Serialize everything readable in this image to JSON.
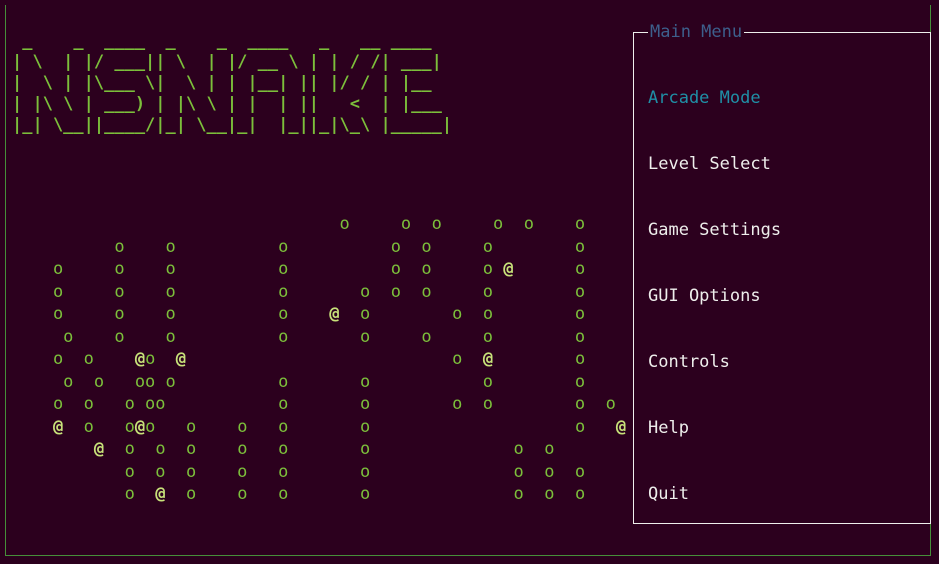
{
  "menu": {
    "title": "Main Menu",
    "selected_index": 0,
    "items": [
      "Arcade Mode",
      "Level Select",
      "Game Settings",
      "GUI Options",
      "Controls",
      "Help",
      "Quit"
    ]
  },
  "title_ascii": " _  __ ____  _  __ ____   _   __ ____ \n| |/ // ___|| |/ // __ \\ | | / // ___|\n|   | \\___ \\|   || |__| || |/ / | |__ \n| |\\ \\ ___) | |\\ || |  | ||   \\ | |___\n|_| \\_|____/|_| \\_|_|  |_||_|\\_\\|_____|",
  "title_ascii_rows": [
    " _    _  ____  _    _  ____   _   __ ____",
    "| \\  | |/ ___|| \\  | |/ __ \\ | | / /| ___|",
    "|  \\ | |\\___ \\|  \\ | | |__| || |/ / | |__",
    "| |\\ \\ | ___) | |\\ \\ | |  | ||   <  | |___",
    "|_| \\__||____/|_| \\__|_|  |_||_|\\_\\ |_____|"
  ],
  "playfield_rows": [
    "                                o     o  o     o  o    o",
    "          o    o          o          o  o     o        o",
    "    o     o    o          o          o  o     o @      o",
    "    o     o    o          o       o  o  o     o        o",
    "    o     o    o          o    @  o        o  o        o",
    "     o    o    o          o       o     o     o        o",
    "    o  o    @o  @                          o  @        o",
    "     o  o   oo o          o       o           o        o",
    "    o  o   o oo           o       o        o  o        o  o",
    "    @  o   o@o   o    o   o       o                    o   @",
    "        @  o  o  o    o   o       o              o  o",
    "           o  o  o    o   o       o              o  o  o",
    "           o  @  o    o   o       o              o  o  o"
  ],
  "glyphs": {
    "snake": "o",
    "food": "@"
  },
  "colors": {
    "bg": "#2c001e",
    "green": "#7cbf3b",
    "bright_green": "#c8e27a",
    "white": "#eeeeec",
    "cyan": "#1f8fa6",
    "blue": "#3d5f8c"
  }
}
